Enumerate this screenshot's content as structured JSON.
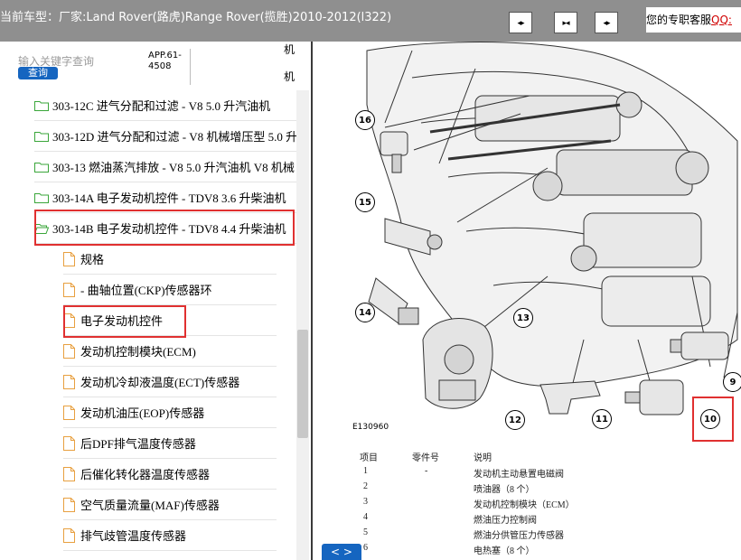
{
  "header": {
    "vehicle_label": "当前车型：",
    "vehicle_value": "厂家:Land Rover(路虎)Range Rover(揽胜)2010-2012(l322)",
    "buttons": [
      {
        "name": "prev",
        "glyph": "◂▸"
      },
      {
        "name": "split",
        "glyph": "▸◂"
      },
      {
        "name": "next",
        "glyph": "◂▸"
      }
    ],
    "service_text": "您的专职客服",
    "service_link": "QQ:"
  },
  "search": {
    "placeholder": "输入关键字查询",
    "button_label": "查询",
    "app_code": "APP.61-4508",
    "cut_char_1": "机",
    "cut_char_2": "机"
  },
  "tree": {
    "folders": [
      {
        "label": "303-12C 进气分配和过滤 - V8 5.0 升汽油机"
      },
      {
        "label": "303-12D 进气分配和过滤 - V8 机械增压型 5.0 升"
      },
      {
        "label": "303-13 燃油蒸汽排放 - V8 5.0 升汽油机 V8 机械"
      },
      {
        "label": "303-14A 电子发动机控件 - TDV8 3.6 升柴油机"
      },
      {
        "label": "303-14B 电子发动机控件 - TDV8 4.4 升柴油机"
      }
    ],
    "pages": [
      {
        "label": "规格"
      },
      {
        "label": "- 曲轴位置(CKP)传感器环"
      },
      {
        "label": "电子发动机控件"
      },
      {
        "label": "发动机控制模块(ECM)"
      },
      {
        "label": "发动机冷却液温度(ECT)传感器"
      },
      {
        "label": "发动机油压(EOP)传感器"
      },
      {
        "label": "后DPF排气温度传感器"
      },
      {
        "label": "后催化转化器温度传感器"
      },
      {
        "label": "空气质量流量(MAF)传感器"
      },
      {
        "label": "排气歧管温度传感器"
      }
    ]
  },
  "diagram": {
    "figure_id": "E130960",
    "callouts": [
      "16",
      "15",
      "14",
      "13",
      "12",
      "11",
      "10",
      "9"
    ],
    "parts_table": {
      "headers": [
        "项目",
        "零件号",
        "说明"
      ],
      "rows": [
        {
          "item": "1",
          "part": "-",
          "desc": "发动机主动悬置电磁阀"
        },
        {
          "item": "2",
          "part": "",
          "desc": "喷油器（8 个）"
        },
        {
          "item": "3",
          "part": "",
          "desc": "发动机控制模块（ECM）"
        },
        {
          "item": "4",
          "part": "",
          "desc": "燃油压力控制阀"
        },
        {
          "item": "5",
          "part": "",
          "desc": "燃油分供管压力传感器"
        },
        {
          "item": "6",
          "part": "",
          "desc": "电热塞（8 个）"
        }
      ]
    },
    "nav_label": "< >"
  },
  "colors": {
    "header_bg": "#8f8f8f",
    "highlight": "#e03030",
    "accent": "#1565c0",
    "folder_icon": "#3aa63a",
    "page_icon": "#e8a040"
  }
}
